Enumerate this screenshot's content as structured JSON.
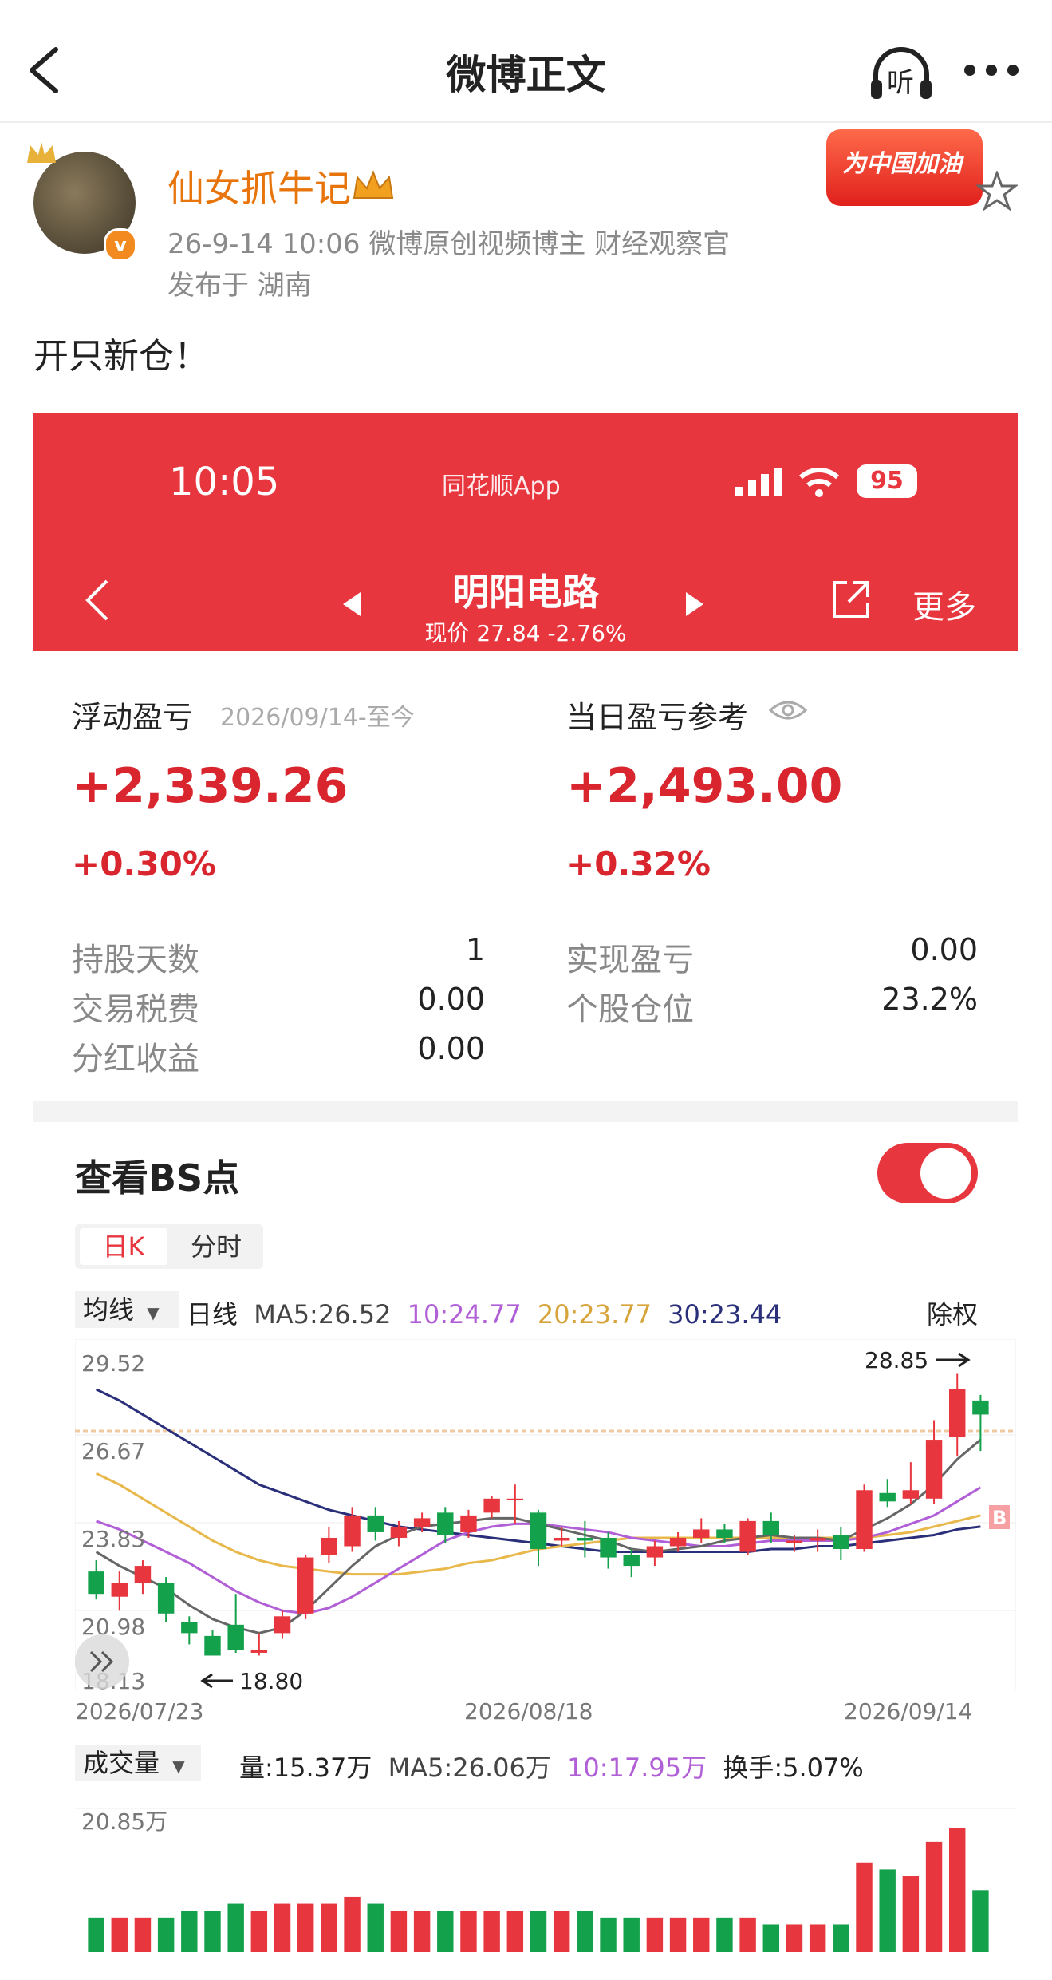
{
  "nav": {
    "title": "微博正文",
    "listen_label": "听"
  },
  "post": {
    "author": "仙女抓牛记",
    "meta": "26-9-14 10:06  微博原创视频博主 财经观察官",
    "location": "发布于 湖南",
    "text": "开只新仓！",
    "badge": "为中国加油"
  },
  "phone": {
    "time": "10:05",
    "app_name": "同花顺App",
    "battery": "95",
    "stock_name": "明阳电路",
    "price_line": "现价 27.84  -2.76%",
    "more_label": "更多"
  },
  "pl": {
    "float_label": "浮动盈亏",
    "float_range": "2026/09/14-至今",
    "float_value": "+2,339.26",
    "float_pct": "+0.30%",
    "daily_label": "当日盈亏参考",
    "daily_value": "+2,493.00",
    "daily_pct": "+0.32%",
    "stats_left": [
      {
        "label": "持股天数",
        "value": "1"
      },
      {
        "label": "交易税费",
        "value": "0.00"
      },
      {
        "label": "分红收益",
        "value": "0.00"
      }
    ],
    "stats_right": [
      {
        "label": "实现盈亏",
        "value": "0.00"
      },
      {
        "label": "个股仓位",
        "value": "23.2%"
      }
    ]
  },
  "bs": {
    "title": "查看BS点",
    "tab_day": "日K",
    "tab_intraday": "分时",
    "ma_selector": "均线",
    "ma_line_label": "日线",
    "ma5": "MA5:26.52",
    "ma10": "10:24.77",
    "ma20": "20:23.77",
    "ma30": "30:23.44",
    "exright": "除权",
    "y_ticks": [
      "29.52",
      "26.67",
      "23.83",
      "20.98",
      "18.13"
    ],
    "x_ticks": [
      "2026/07/23",
      "2026/08/18",
      "2026/09/14"
    ],
    "high_note": "28.85",
    "low_note": "18.80",
    "bs_marker": "B",
    "vol_selector": "成交量",
    "vol_line": "量:15.37万",
    "vol_ma5": "MA5:26.06万",
    "vol_ma10": "10:17.95万",
    "turnover": "换手:5.07%",
    "vol_tick": "20.85万"
  },
  "colors": {
    "up": "#e8363e",
    "down": "#13a14b",
    "ma5": "#666666",
    "ma10": "#b15fd6",
    "ma20": "#e8b84a",
    "ma30": "#2a2f7a"
  },
  "chart_data": {
    "type": "candlestick",
    "ylim": [
      18.13,
      29.52
    ],
    "x_labels": [
      "2026/07/23",
      "2026/08/18",
      "2026/09/14"
    ],
    "candles": [
      {
        "o": 21.8,
        "c": 21.0,
        "h": 22.2,
        "l": 20.8
      },
      {
        "o": 20.9,
        "c": 21.4,
        "h": 21.8,
        "l": 20.4
      },
      {
        "o": 21.4,
        "c": 22.0,
        "h": 22.2,
        "l": 21.0
      },
      {
        "o": 21.4,
        "c": 20.3,
        "h": 21.6,
        "l": 20.0
      },
      {
        "o": 20.0,
        "c": 19.6,
        "h": 20.2,
        "l": 19.2
      },
      {
        "o": 19.5,
        "c": 18.8,
        "h": 19.7,
        "l": 18.8
      },
      {
        "o": 19.9,
        "c": 19.0,
        "h": 21.0,
        "l": 18.9
      },
      {
        "o": 18.9,
        "c": 19.0,
        "h": 19.6,
        "l": 18.8
      },
      {
        "o": 19.6,
        "c": 20.2,
        "h": 20.4,
        "l": 19.4
      },
      {
        "o": 20.3,
        "c": 22.3,
        "h": 22.4,
        "l": 20.1
      },
      {
        "o": 22.4,
        "c": 23.0,
        "h": 23.4,
        "l": 22.1
      },
      {
        "o": 22.7,
        "c": 23.8,
        "h": 24.1,
        "l": 22.5
      },
      {
        "o": 23.8,
        "c": 23.2,
        "h": 24.1,
        "l": 22.9
      },
      {
        "o": 23.0,
        "c": 23.4,
        "h": 23.6,
        "l": 22.7
      },
      {
        "o": 23.4,
        "c": 23.7,
        "h": 23.9,
        "l": 23.2
      },
      {
        "o": 23.9,
        "c": 23.1,
        "h": 24.1,
        "l": 22.8
      },
      {
        "o": 23.2,
        "c": 23.8,
        "h": 24.0,
        "l": 23.0
      },
      {
        "o": 23.9,
        "c": 24.4,
        "h": 24.5,
        "l": 23.7
      },
      {
        "o": 24.4,
        "c": 24.4,
        "h": 24.9,
        "l": 23.5
      },
      {
        "o": 23.9,
        "c": 22.6,
        "h": 24.0,
        "l": 22.0
      },
      {
        "o": 22.9,
        "c": 23.0,
        "h": 23.4,
        "l": 22.7
      },
      {
        "o": 23.0,
        "c": 22.9,
        "h": 23.6,
        "l": 22.3
      },
      {
        "o": 23.0,
        "c": 22.3,
        "h": 23.2,
        "l": 21.9
      },
      {
        "o": 22.4,
        "c": 22.0,
        "h": 22.6,
        "l": 21.6
      },
      {
        "o": 22.3,
        "c": 22.7,
        "h": 22.9,
        "l": 22.0
      },
      {
        "o": 22.7,
        "c": 23.0,
        "h": 23.2,
        "l": 22.5
      },
      {
        "o": 23.0,
        "c": 23.3,
        "h": 23.7,
        "l": 22.8
      },
      {
        "o": 23.3,
        "c": 23.0,
        "h": 23.5,
        "l": 22.8
      },
      {
        "o": 22.5,
        "c": 23.6,
        "h": 23.7,
        "l": 22.4
      },
      {
        "o": 23.6,
        "c": 23.1,
        "h": 23.9,
        "l": 22.8
      },
      {
        "o": 22.8,
        "c": 22.9,
        "h": 23.1,
        "l": 22.5
      },
      {
        "o": 22.9,
        "c": 23.0,
        "h": 23.3,
        "l": 22.5
      },
      {
        "o": 23.1,
        "c": 22.6,
        "h": 23.4,
        "l": 22.2
      },
      {
        "o": 22.6,
        "c": 24.7,
        "h": 24.9,
        "l": 22.5
      },
      {
        "o": 24.6,
        "c": 24.3,
        "h": 25.1,
        "l": 24.1
      },
      {
        "o": 24.4,
        "c": 24.7,
        "h": 25.7,
        "l": 24.2
      },
      {
        "o": 24.4,
        "c": 26.5,
        "h": 27.2,
        "l": 24.2
      },
      {
        "o": 26.6,
        "c": 28.3,
        "h": 28.85,
        "l": 25.9
      },
      {
        "o": 27.9,
        "c": 27.4,
        "h": 28.1,
        "l": 26.1
      }
    ],
    "volume": [
      5,
      5,
      5,
      5,
      6,
      6,
      7,
      6,
      7,
      7,
      7,
      8,
      7,
      6,
      6,
      6,
      6,
      6,
      6,
      6,
      6,
      6,
      5,
      5,
      5,
      5,
      5,
      5,
      5,
      4,
      4,
      4,
      4,
      13,
      12,
      11,
      16,
      18,
      9
    ],
    "volume_ylim": [
      0,
      20.85
    ],
    "ma5": [
      22.5,
      22.0,
      21.6,
      21.2,
      20.6,
      20.1,
      19.8,
      19.6,
      19.8,
      20.4,
      21.2,
      22.0,
      22.7,
      23.1,
      23.4,
      23.5,
      23.6,
      23.7,
      23.7,
      23.5,
      23.3,
      23.1,
      22.9,
      22.6,
      22.5,
      22.6,
      22.7,
      22.9,
      23.0,
      23.1,
      23.0,
      23.0,
      22.9,
      23.3,
      23.7,
      24.2,
      24.9,
      25.8,
      26.5
    ],
    "ma10": [
      23.6,
      23.3,
      22.9,
      22.5,
      22.1,
      21.6,
      21.1,
      20.7,
      20.4,
      20.3,
      20.5,
      20.9,
      21.4,
      21.9,
      22.4,
      22.9,
      23.2,
      23.4,
      23.5,
      23.5,
      23.4,
      23.3,
      23.2,
      23.0,
      22.9,
      22.8,
      22.7,
      22.7,
      22.8,
      22.9,
      22.9,
      22.9,
      22.9,
      23.0,
      23.2,
      23.5,
      23.8,
      24.3,
      24.8
    ],
    "ma20": [
      25.3,
      24.9,
      24.4,
      23.9,
      23.4,
      22.9,
      22.5,
      22.2,
      22.0,
      21.9,
      21.8,
      21.7,
      21.7,
      21.7,
      21.8,
      21.9,
      22.1,
      22.2,
      22.4,
      22.6,
      22.7,
      22.8,
      22.9,
      23.0,
      23.0,
      23.0,
      23.0,
      23.0,
      23.0,
      23.0,
      23.0,
      23.0,
      23.0,
      23.0,
      23.1,
      23.2,
      23.4,
      23.6,
      23.8
    ],
    "ma30": [
      28.3,
      27.9,
      27.4,
      26.9,
      26.4,
      25.9,
      25.4,
      24.9,
      24.6,
      24.3,
      24.0,
      23.8,
      23.6,
      23.4,
      23.3,
      23.2,
      23.1,
      23.0,
      22.9,
      22.8,
      22.7,
      22.6,
      22.5,
      22.5,
      22.5,
      22.5,
      22.5,
      22.5,
      22.5,
      22.6,
      22.6,
      22.7,
      22.7,
      22.8,
      22.9,
      23.0,
      23.1,
      23.3,
      23.4
    ]
  }
}
